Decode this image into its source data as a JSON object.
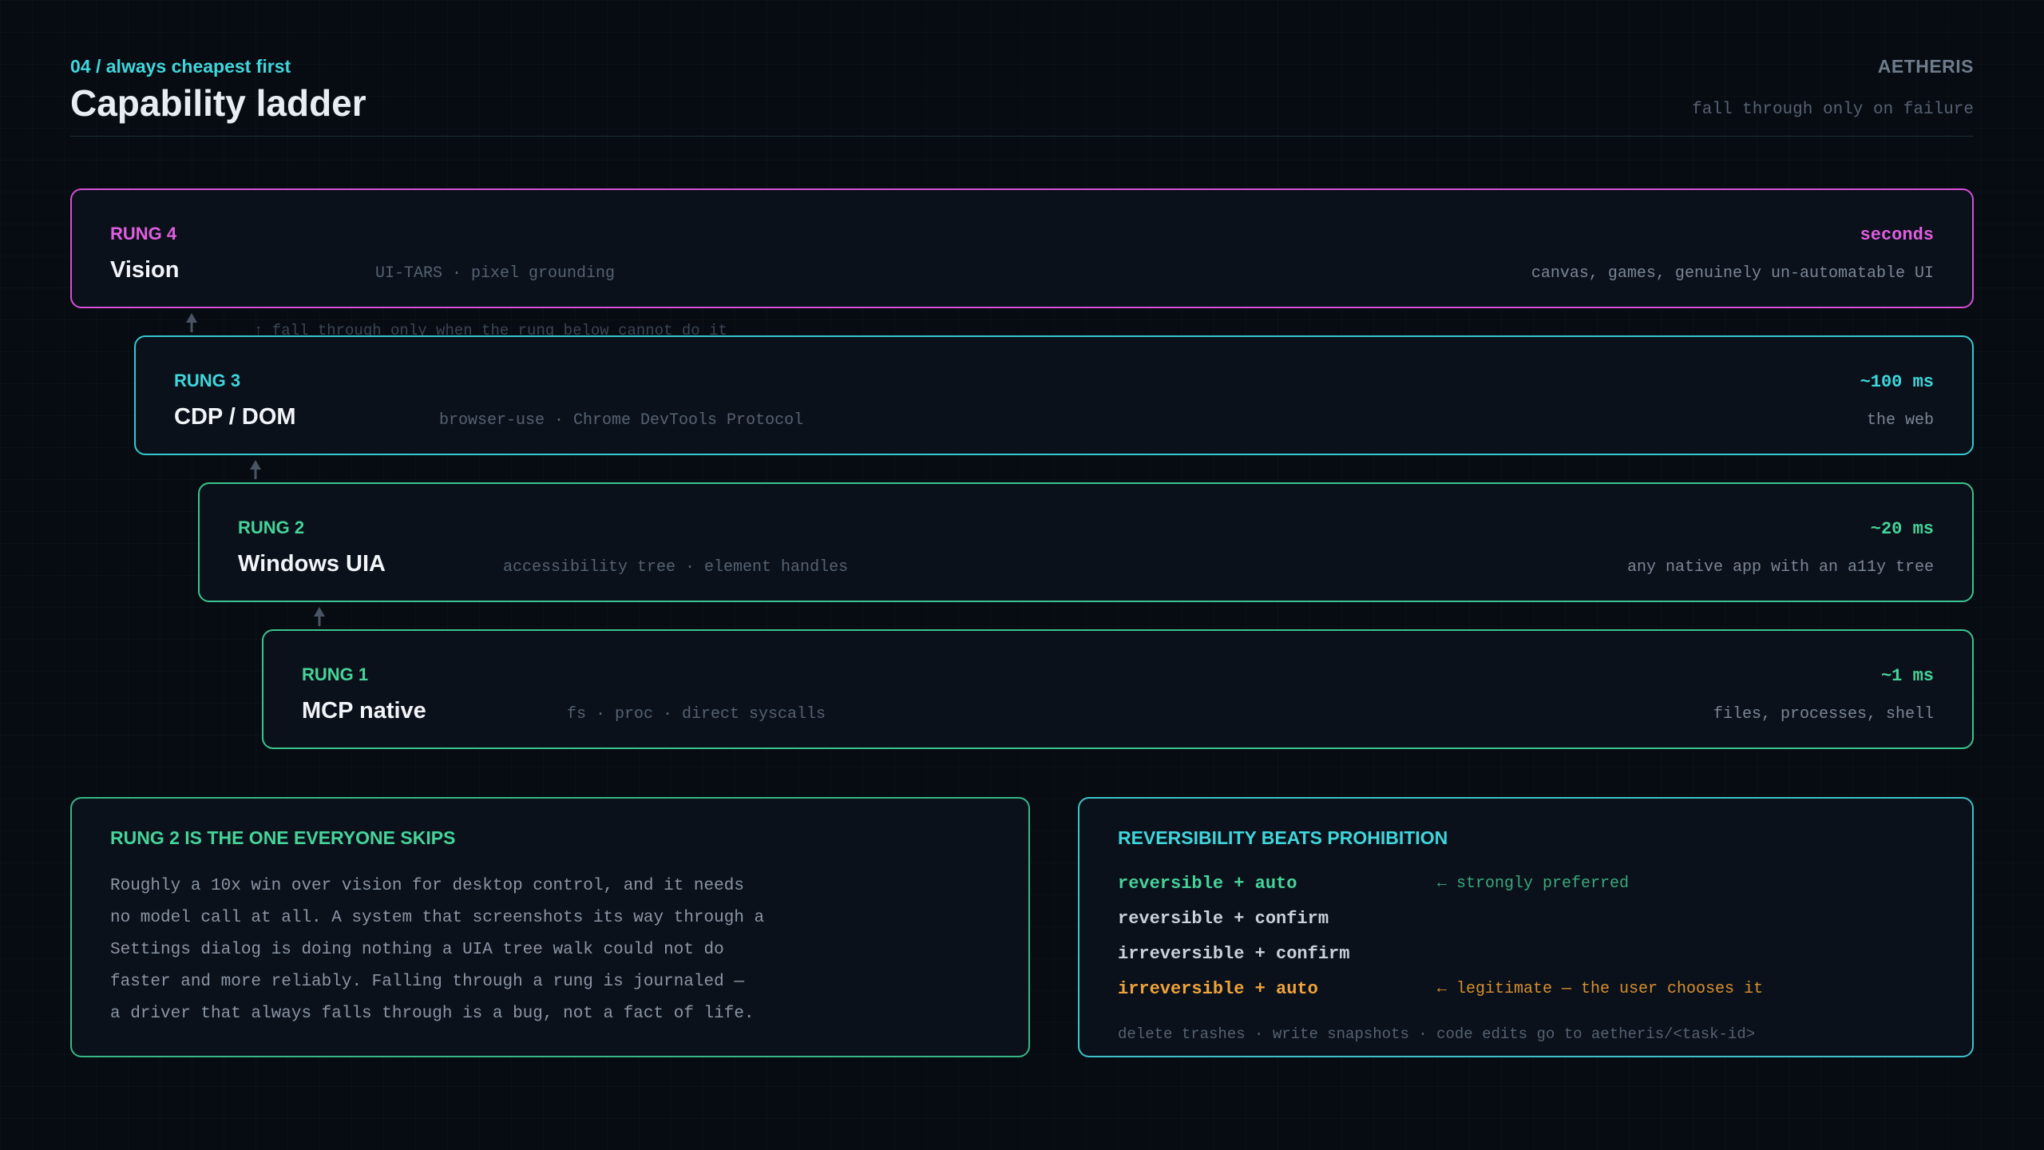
{
  "header": {
    "kicker_num": "04",
    "kicker_sep": " / ",
    "kicker_text": "always cheapest first",
    "title": "Capability ladder",
    "brand": "AETHERIS",
    "subtitle": "fall through only on failure"
  },
  "fall_note": "↑ fall through only when the rung below cannot do it",
  "rungs": [
    {
      "label": "RUNG 4",
      "name": "Vision",
      "tech": "UI-TARS · pixel grounding",
      "latency": "seconds",
      "scope": "canvas, games, genuinely un-automatable UI",
      "color": "#d64fd6"
    },
    {
      "label": "RUNG 3",
      "name": "CDP / DOM",
      "tech": "browser-use · Chrome DevTools Protocol",
      "latency": "~100 ms",
      "scope": "the web",
      "color": "#36c9cf"
    },
    {
      "label": "RUNG 2",
      "name": "Windows UIA",
      "tech": "accessibility tree · element handles",
      "latency": "~20 ms",
      "scope": "any native app with an a11y tree",
      "color": "#3ac48e"
    },
    {
      "label": "RUNG 1",
      "name": "MCP native",
      "tech": "fs · proc · direct syscalls",
      "latency": "~1 ms",
      "scope": "files, processes, shell",
      "color": "#3ac48e"
    }
  ],
  "left_card": {
    "title": "RUNG 2 IS THE ONE EVERYONE SKIPS",
    "lines": [
      "Roughly a 10x win over vision for desktop control, and it needs",
      "no model call at all. A system that screenshots its way through a",
      "Settings dialog is doing nothing a UIA tree walk could not do",
      "faster and more reliably. Falling through a rung is journaled —",
      "a driver that always falls through is a bug, not a fact of life."
    ]
  },
  "right_card": {
    "title": "REVERSIBILITY BEATS PROHIBITION",
    "modes": [
      {
        "name": "reversible + auto",
        "note": "← strongly preferred"
      },
      {
        "name": "reversible + confirm",
        "note": ""
      },
      {
        "name": "irreversible + confirm",
        "note": ""
      },
      {
        "name": "irreversible + auto",
        "note": "← legitimate — the user chooses it"
      }
    ],
    "footer": "delete trashes · write snapshots · code edits go to aetheris/<task-id>"
  }
}
